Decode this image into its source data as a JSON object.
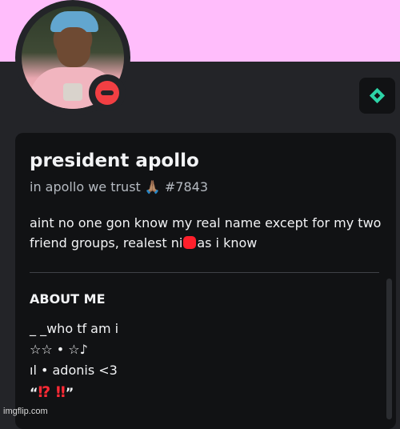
{
  "profile": {
    "display_name": "president apollo",
    "tag": "in apollo we trust 🙏🏽 #7843",
    "bio_part1": "aint no one gon know my real name except for my two friend groups, realest ni",
    "bio_part2": "as i know",
    "status": "do-not-disturb",
    "banner_color": "#ffbdfb"
  },
  "about": {
    "title": "ABOUT ME",
    "lines": [
      "_ _who tf am i",
      "☆☆ • ☆♪",
      "ıl • adonis <3"
    ],
    "quote_open": "“",
    "quote_marks": "⁉ ‼",
    "quote_close": "”"
  },
  "icons": {
    "status": "dnd-status-icon",
    "badge": "nitro-gem-icon"
  },
  "watermark": "imgflip.com"
}
